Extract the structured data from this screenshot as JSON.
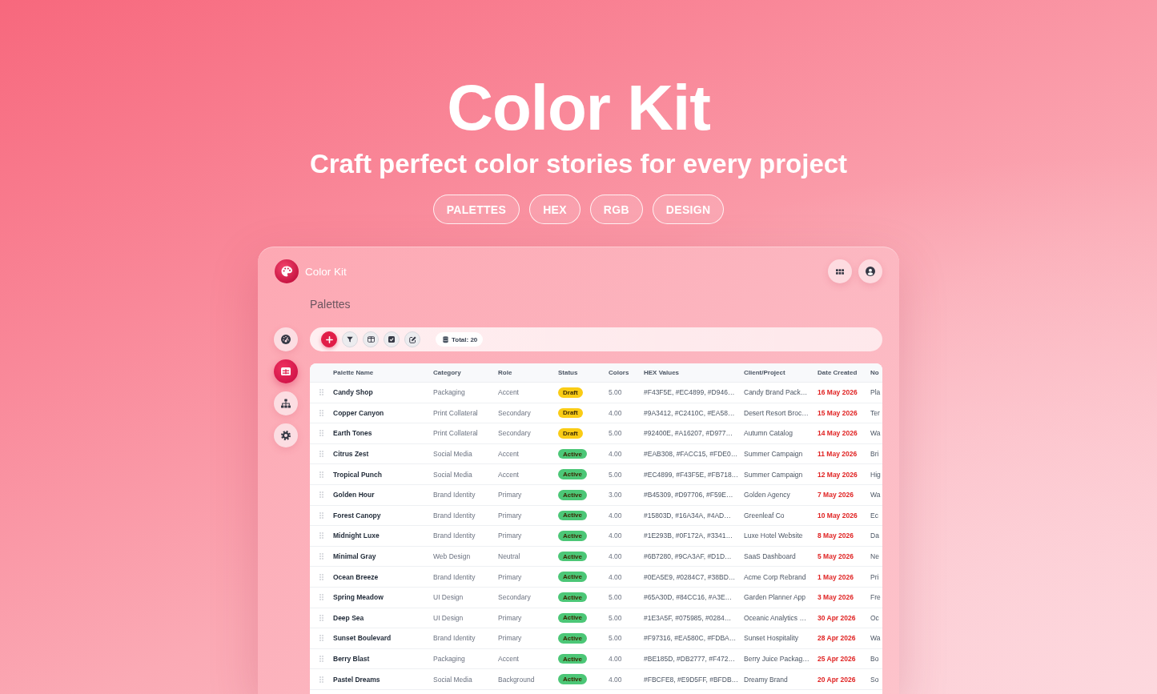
{
  "hero": {
    "title": "Color Kit",
    "subtitle": "Craft perfect color stories for every project",
    "tags": [
      "PALETTES",
      "HEX",
      "RGB",
      "DESIGN"
    ]
  },
  "app": {
    "brand": "Color Kit",
    "page_title": "Palettes",
    "sidebar": {
      "items": [
        {
          "selected": false
        },
        {
          "selected": true
        },
        {
          "selected": false
        },
        {
          "selected": false
        }
      ]
    },
    "toolbar": {
      "total": "Total: 20"
    },
    "table": {
      "columns": [
        "Palette Name",
        "Category",
        "Role",
        "Status",
        "Colors",
        "HEX Values",
        "Client/Project",
        "Date Created",
        "No"
      ],
      "rows": [
        {
          "name": "Candy Shop",
          "category": "Packaging",
          "role": "Accent",
          "status": {
            "text": "Draft",
            "color": "#facc15"
          },
          "colors": "5.00",
          "hex_values": "#F43F5E, #EC4899, #D946…",
          "client_project": "Candy Brand Pack…",
          "date_created": "16 May 2026",
          "column_9": "Pla"
        },
        {
          "name": "Copper Canyon",
          "category": "Print Collateral",
          "role": "Secondary",
          "status": {
            "text": "Draft",
            "color": "#facc15"
          },
          "colors": "4.00",
          "hex_values": "#9A3412, #C2410C, #EA58…",
          "client_project": "Desert Resort Broc…",
          "date_created": "15 May 2026",
          "column_9": "Ter"
        },
        {
          "name": "Earth Tones",
          "category": "Print Collateral",
          "role": "Secondary",
          "status": {
            "text": "Draft",
            "color": "#facc15"
          },
          "colors": "5.00",
          "hex_values": "#92400E, #A16207, #D977…",
          "client_project": "Autumn Catalog",
          "date_created": "14 May 2026",
          "column_9": "Wa"
        },
        {
          "name": "Citrus Zest",
          "category": "Social Media",
          "role": "Accent",
          "status": {
            "text": "Active",
            "color": "#4cc777"
          },
          "colors": "4.00",
          "hex_values": "#EAB308, #FACC15, #FDE0…",
          "client_project": "Summer Campaign",
          "date_created": "11 May 2026",
          "column_9": "Bri"
        },
        {
          "name": "Tropical Punch",
          "category": "Social Media",
          "role": "Accent",
          "status": {
            "text": "Active",
            "color": "#4cc777"
          },
          "colors": "5.00",
          "hex_values": "#EC4899, #F43F5E, #FB718…",
          "client_project": "Summer Campaign",
          "date_created": "12 May 2026",
          "column_9": "Hig"
        },
        {
          "name": "Golden Hour",
          "category": "Brand Identity",
          "role": "Primary",
          "status": {
            "text": "Active",
            "color": "#4cc777"
          },
          "colors": "3.00",
          "hex_values": "#B45309, #D97706, #F59E…",
          "client_project": "Golden Agency",
          "date_created": "7 May 2026",
          "column_9": "Wa"
        },
        {
          "name": "Forest Canopy",
          "category": "Brand Identity",
          "role": "Primary",
          "status": {
            "text": "Active",
            "color": "#4cc777"
          },
          "colors": "4.00",
          "hex_values": "#15803D, #16A34A, #4AD…",
          "client_project": "Greenleaf Co",
          "date_created": "10 May 2026",
          "column_9": "Ec"
        },
        {
          "name": "Midnight Luxe",
          "category": "Brand Identity",
          "role": "Primary",
          "status": {
            "text": "Active",
            "color": "#4cc777"
          },
          "colors": "4.00",
          "hex_values": "#1E293B, #0F172A, #3341…",
          "client_project": "Luxe Hotel Website",
          "date_created": "8 May 2026",
          "column_9": "Da"
        },
        {
          "name": "Minimal Gray",
          "category": "Web Design",
          "role": "Neutral",
          "status": {
            "text": "Active",
            "color": "#4cc777"
          },
          "colors": "4.00",
          "hex_values": "#6B7280, #9CA3AF, #D1D…",
          "client_project": "SaaS Dashboard",
          "date_created": "5 May 2026",
          "column_9": "Ne"
        },
        {
          "name": "Ocean Breeze",
          "category": "Brand Identity",
          "role": "Primary",
          "status": {
            "text": "Active",
            "color": "#4cc777"
          },
          "colors": "4.00",
          "hex_values": "#0EA5E9, #0284C7, #38BD…",
          "client_project": "Acme Corp Rebrand",
          "date_created": "1 May 2026",
          "column_9": "Pri"
        },
        {
          "name": "Spring Meadow",
          "category": "UI Design",
          "role": "Secondary",
          "status": {
            "text": "Active",
            "color": "#4cc777"
          },
          "colors": "5.00",
          "hex_values": "#65A30D, #84CC16, #A3E…",
          "client_project": "Garden Planner App",
          "date_created": "3 May 2026",
          "column_9": "Fre"
        },
        {
          "name": "Deep Sea",
          "category": "UI Design",
          "role": "Primary",
          "status": {
            "text": "Active",
            "color": "#4cc777"
          },
          "colors": "5.00",
          "hex_values": "#1E3A5F, #075985, #0284…",
          "client_project": "Oceanic Analytics …",
          "date_created": "30 Apr 2026",
          "column_9": "Oc"
        },
        {
          "name": "Sunset Boulevard",
          "category": "Brand Identity",
          "role": "Primary",
          "status": {
            "text": "Active",
            "color": "#4cc777"
          },
          "colors": "5.00",
          "hex_values": "#F97316, #EA580C, #FDBA…",
          "client_project": "Sunset Hospitality",
          "date_created": "28 Apr 2026",
          "column_9": "Wa"
        },
        {
          "name": "Berry Blast",
          "category": "Packaging",
          "role": "Accent",
          "status": {
            "text": "Active",
            "color": "#4cc777"
          },
          "colors": "4.00",
          "hex_values": "#BE185D, #DB2777, #F472…",
          "client_project": "Berry Juice Packag…",
          "date_created": "25 Apr 2026",
          "column_9": "Bo"
        },
        {
          "name": "Pastel Dreams",
          "category": "Social Media",
          "role": "Background",
          "status": {
            "text": "Active",
            "color": "#4cc777"
          },
          "colors": "4.00",
          "hex_values": "#FBCFE8, #E9D5FF, #BFDB…",
          "client_project": "Dreamy Brand",
          "date_created": "20 Apr 2026",
          "column_9": "So"
        }
      ]
    }
  }
}
